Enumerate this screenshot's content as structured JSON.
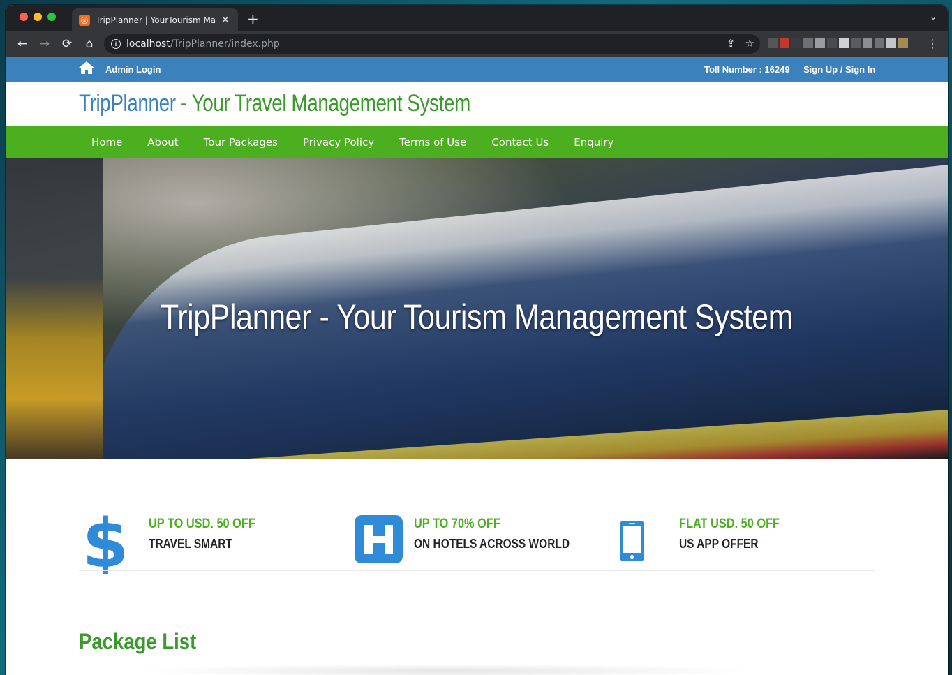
{
  "browser": {
    "tab_title": "TripPlanner | YourTourism Mana",
    "tab_close": "✕",
    "new_tab": "+",
    "tab_menu": "⌄",
    "url_host": "localhost",
    "url_path": "/TripPlanner/index.php",
    "back": "←",
    "forward": "→",
    "reload": "⟳",
    "home": "⌂",
    "share": "⇪",
    "bookmark": "☆",
    "menu": "⋮"
  },
  "topbar": {
    "admin_login": "Admin Login",
    "toll_number": "Toll Number : 16249",
    "signup_signin": "Sign Up / Sign In",
    "bg_color": "#3b82bd"
  },
  "header": {
    "brand_part1": "TripPlanner",
    "brand_part2": " - Your Travel Management System"
  },
  "nav": {
    "items": [
      "Home",
      "About",
      "Tour Packages",
      "Privacy Policy",
      "Terms of Use",
      "Contact Us",
      "Enquiry"
    ],
    "bg_color": "#4caf1f"
  },
  "hero": {
    "title": "TripPlanner - Your Tourism Management System"
  },
  "offers": [
    {
      "icon": "dollar-icon",
      "title": "UP TO USD. 50 OFF",
      "subtitle": "TRAVEL SMART"
    },
    {
      "icon": "hotel-icon",
      "title": "UP TO 70% OFF",
      "subtitle": "ON HOTELS ACROSS WORLD"
    },
    {
      "icon": "mobile-icon",
      "title": "FLAT USD. 50 OFF",
      "subtitle": "US APP OFFER"
    }
  ],
  "package_list": {
    "title": "Package List"
  },
  "colors": {
    "accent_blue": "#3b82bd",
    "accent_green": "#4caf1f",
    "icon_blue": "#2f8ad8"
  }
}
